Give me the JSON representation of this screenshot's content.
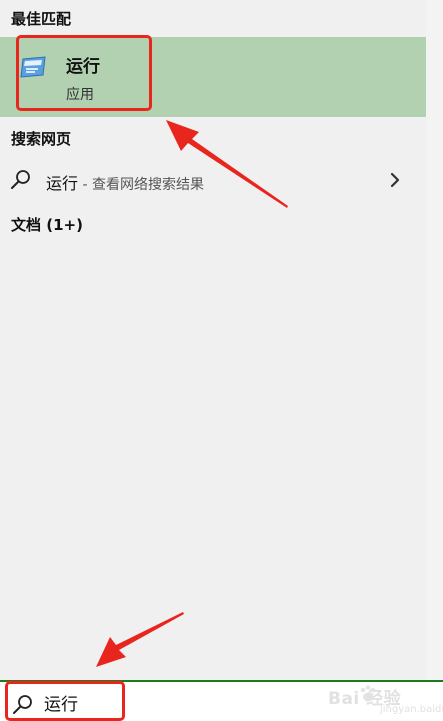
{
  "best_match": {
    "header": "最佳匹配",
    "app_name": "运行",
    "app_type": "应用"
  },
  "web_search": {
    "header": "搜索网页",
    "query": "运行",
    "suffix": " - 查看网络搜索结果"
  },
  "documents": {
    "header": "文档 (1+)"
  },
  "search_bar": {
    "value": "运行"
  },
  "watermark": {
    "text": "Bai 经验",
    "sub": "jingyan.baidu.com"
  },
  "colors": {
    "selected_bg": "#b1d1b0",
    "annotation_red": "#e8261e",
    "search_border": "#1e7a1e"
  }
}
